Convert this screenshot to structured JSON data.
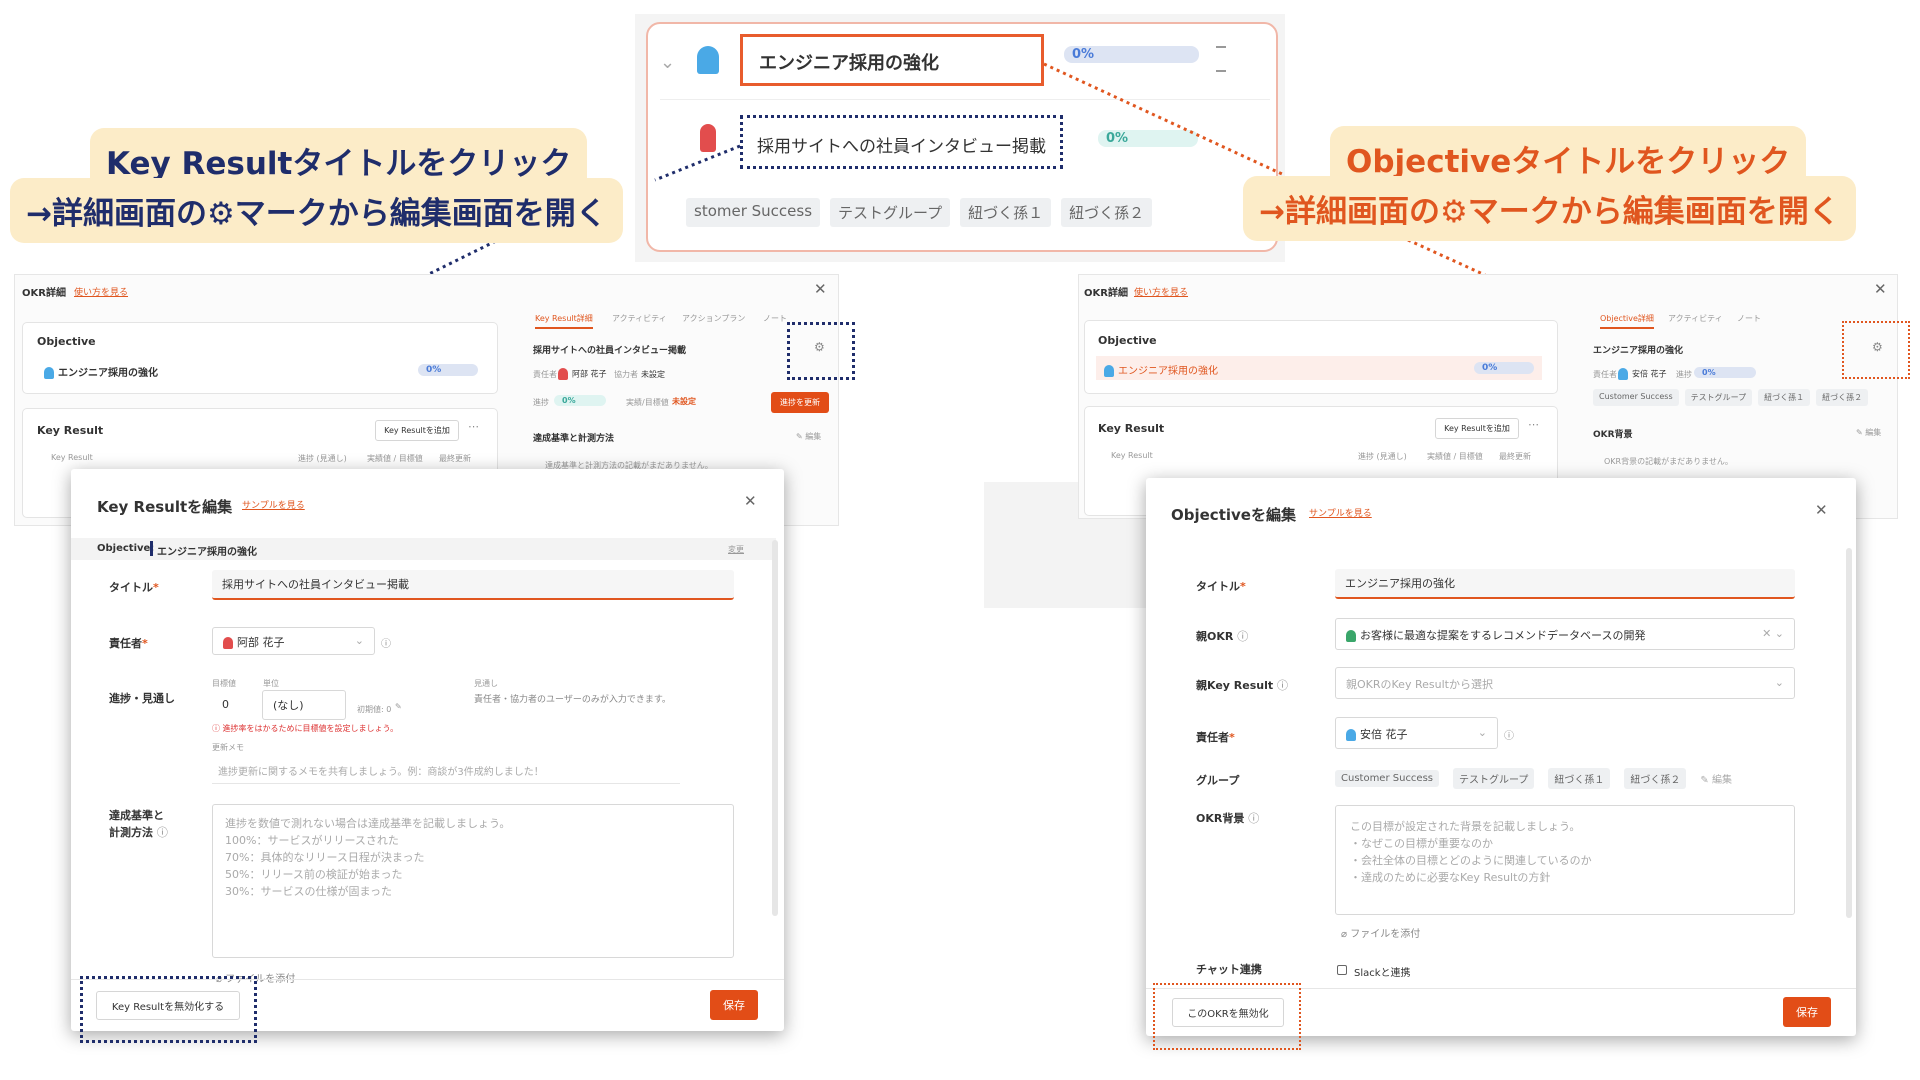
{
  "top_snippet": {
    "objective_title": "エンジニア採用の強化",
    "objective_progress": "0%",
    "kr_title": "採用サイトへの社員インタビュー掲載",
    "kr_progress": "0%",
    "tags": [
      "stomer Success",
      "テストグループ",
      "紐づく孫１",
      "紐づく孫２"
    ]
  },
  "callouts": {
    "left_line1": "Key Resultタイトルをクリック",
    "left_line2": "→詳細画面の⚙マークから編集画面を開く",
    "right_line1": "Objectiveタイトルをクリック",
    "right_line2": "→詳細画面の⚙マークから編集画面を開く"
  },
  "left_detail": {
    "header": "OKR詳細",
    "howto": "使い方を見る",
    "objective_label": "Objective",
    "objective_title": "エンジニア採用の強化",
    "objective_progress": "0%",
    "kr_section": "Key Result",
    "add_kr": "Key Resultを追加",
    "col_kr": "Key Result",
    "col_progress": "進捗 (見通し)",
    "col_actual": "実績値 / 目標値",
    "col_updated": "最終更新",
    "tabs": [
      "Key Result詳細",
      "アクティビティ",
      "アクションプラン",
      "ノート"
    ],
    "kr_title": "採用サイトへの社員インタビュー掲載",
    "owner_label": "責任者",
    "owner": "阿部 花子",
    "collab_label": "協力者",
    "collab": "未設定",
    "progress_label": "進捗",
    "progress": "0%",
    "actual_label": "実績/目標値",
    "actual": "未設定",
    "update_btn": "進捗を更新",
    "criteria": "達成基準と計測方法",
    "edit": "編集",
    "criteria_placeholder": "達成基準と計測方法の記載がまだありません。"
  },
  "kr_modal": {
    "title": "Key Resultを編集",
    "sample": "サンプルを見る",
    "objective_prefix": "Objective:",
    "objective_name": "エンジニア採用の強化",
    "change": "変更",
    "title_label": "タイトル",
    "title_value": "採用サイトへの社員インタビュー掲載",
    "owner_label": "責任者",
    "owner_value": "阿部 花子",
    "progress_label": "進捗・見通し",
    "target_label": "目標値",
    "unit_label": "単位",
    "target_value": "0",
    "unit_value": "(なし)",
    "initial_value": "初期値: 0",
    "outlook_label": "見通し",
    "outlook_note": "責任者・協力者のユーザーのみが入力できます。",
    "warning": "進捗率をはかるために目標値を設定しましょう。",
    "memo_label": "更新メモ",
    "memo_placeholder": "進捗更新に関するメモを共有しましょう。例：商談が3件成約しました！",
    "criteria_label1": "達成基準と",
    "criteria_label2": "計測方法",
    "criteria_lines": [
      "進捗を数値で測れない場合は達成基準を記載しましょう。",
      "100%：サービスがリリースされた",
      "70%：具体的なリリース日程が決まった",
      "50%：リリース前の検証が始まった",
      "30%：サービスの仕様が固まった"
    ],
    "attach": "ファイルを添付",
    "disable_btn": "Key Resultを無効化する",
    "save": "保存"
  },
  "right_detail": {
    "header": "OKR詳細",
    "howto": "使い方を見る",
    "objective_label": "Objective",
    "objective_title": "エンジニア採用の強化",
    "objective_progress": "0%",
    "kr_section": "Key Result",
    "add_kr": "Key Resultを追加",
    "col_kr": "Key Result",
    "col_progress": "進捗 (見通し)",
    "col_actual": "実績値 / 目標値",
    "col_updated": "最終更新",
    "tabs": [
      "Objective詳細",
      "アクティビティ",
      "ノート"
    ],
    "obj_title": "エンジニア採用の強化",
    "owner_label": "責任者",
    "owner": "安倍 花子",
    "progress_label": "進捗",
    "progress": "0%",
    "tags": [
      "Customer Success",
      "テストグループ",
      "紐づく孫１",
      "紐づく孫２"
    ],
    "bg_label": "OKR背景",
    "edit": "編集",
    "bg_placeholder": "OKR背景の記載がまだありません。"
  },
  "obj_modal": {
    "title": "Objectiveを編集",
    "sample": "サンプルを見る",
    "title_label": "タイトル",
    "title_value": "エンジニア採用の強化",
    "parent_okr_label": "親OKR",
    "parent_okr_value": "お客様に最適な提案をするレコメンドデータベースの開発",
    "parent_kr_label": "親Key Result",
    "parent_kr_placeholder": "親OKRのKey Resultから選択",
    "owner_label": "責任者",
    "owner_value": "安倍 花子",
    "group_label": "グループ",
    "groups": [
      "Customer Success",
      "テストグループ",
      "紐づく孫１",
      "紐づく孫２"
    ],
    "group_edit": "編集",
    "bg_label": "OKR背景",
    "bg_lines": [
      "この目標が設定された背景を記載しましょう。",
      "・なぜこの目標が重要なのか",
      "・会社全体の目標とどのように関連しているのか",
      "・達成のために必要なKey Resultの方針"
    ],
    "attach": "ファイルを添付",
    "chat_label": "チャット連携",
    "slack": "Slackと連携",
    "disable_btn": "このOKRを無効化",
    "save": "保存"
  }
}
